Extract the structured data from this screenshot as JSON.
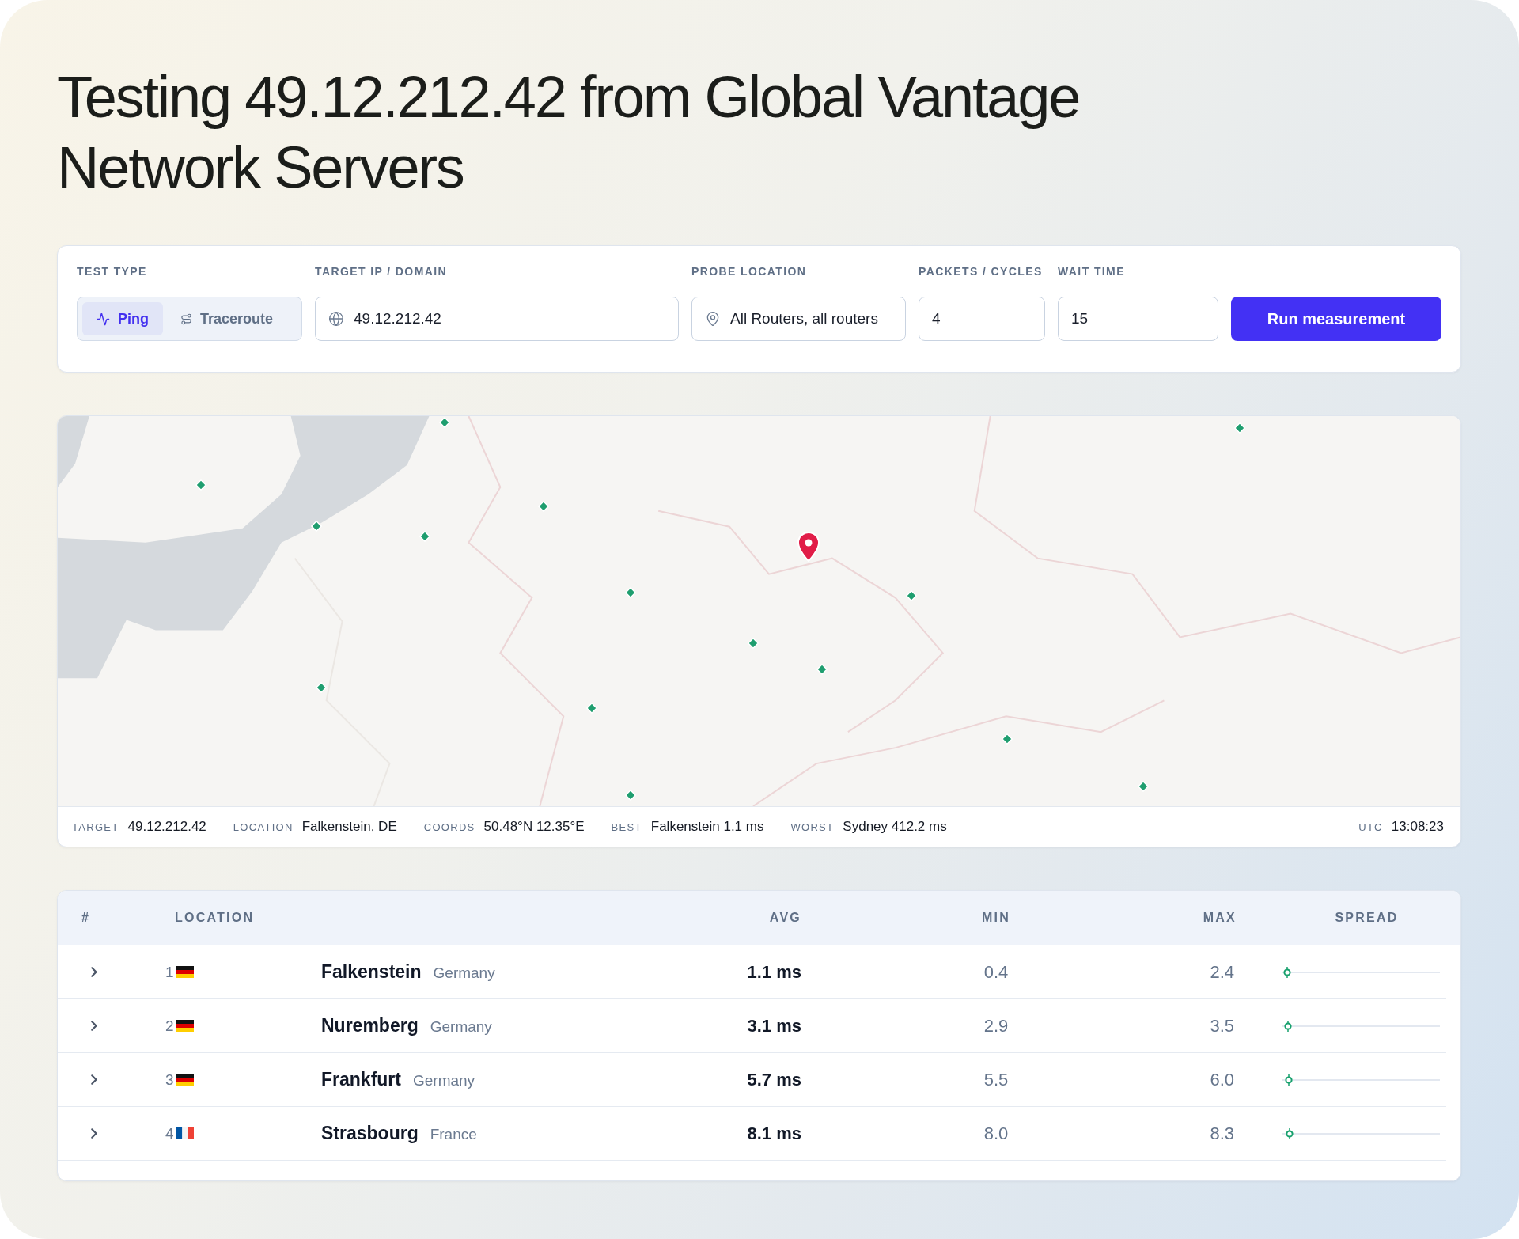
{
  "title": "Testing 49.12.212.42 from Global Vantage Network Servers",
  "form": {
    "test_type": {
      "label": "TEST TYPE",
      "options": [
        {
          "label": "Ping",
          "kind": "ping",
          "selected": true
        },
        {
          "label": "Traceroute",
          "kind": "traceroute",
          "selected": false
        }
      ]
    },
    "fields": [
      {
        "label": "TARGET IP / DOMAIN",
        "kind": "target",
        "value": "49.12.212.42"
      },
      {
        "label": "PROBE LOCATION",
        "kind": "location",
        "value": "All Routers, all routers"
      },
      {
        "label": "PACKETS / CYCLES",
        "kind": "number",
        "value": "4"
      },
      {
        "label": "WAIT TIME",
        "kind": "number",
        "value": "15"
      }
    ],
    "submit": "Run measurement"
  },
  "map": {
    "stats": [
      {
        "label": "TARGET",
        "value": "49.12.212.42"
      },
      {
        "label": "LOCATION",
        "value": "Falkenstein, DE"
      },
      {
        "label": "COORDS",
        "value": "50.48°N 12.35°E"
      },
      {
        "label": "BEST",
        "value": "Falkenstein 1.1 ms"
      },
      {
        "label": "WORST",
        "value": "Sydney 412.2 ms"
      }
    ],
    "clock": {
      "label": "UTC",
      "value": "13:08:23"
    }
  },
  "table": {
    "columns": [
      {
        "label": "#",
        "kind": "expand"
      },
      {
        "label": "LOCATION",
        "kind": "location"
      },
      {
        "label": "AVG",
        "kind": "avg"
      },
      {
        "label": "MIN",
        "kind": "min"
      },
      {
        "label": "MAX",
        "kind": "max"
      },
      {
        "label": "SPREAD",
        "kind": "spread"
      }
    ],
    "rows": [
      {
        "expanded": false,
        "rank": "1",
        "flag": {
          "kind": "de"
        },
        "city": "Falkenstein",
        "country": "Germany",
        "avg": "1.1 ms",
        "min": "0.4",
        "max": "2.4",
        "spread": {
          "level": 0.003
        }
      },
      {
        "expanded": false,
        "rank": "2",
        "flag": {
          "kind": "de"
        },
        "city": "Nuremberg",
        "country": "Germany",
        "avg": "3.1 ms",
        "min": "2.9",
        "max": "3.5",
        "spread": {
          "level": 0.008
        }
      },
      {
        "expanded": false,
        "rank": "3",
        "flag": {
          "kind": "de"
        },
        "city": "Frankfurt",
        "country": "Germany",
        "avg": "5.7 ms",
        "min": "5.5",
        "max": "6.0",
        "spread": {
          "level": 0.014
        }
      },
      {
        "expanded": false,
        "rank": "4",
        "flag": {
          "kind": "fr"
        },
        "city": "Strasbourg",
        "country": "France",
        "avg": "8.1 ms",
        "min": "8.0",
        "max": "8.3",
        "spread": {
          "level": 0.02
        }
      }
    ]
  }
}
